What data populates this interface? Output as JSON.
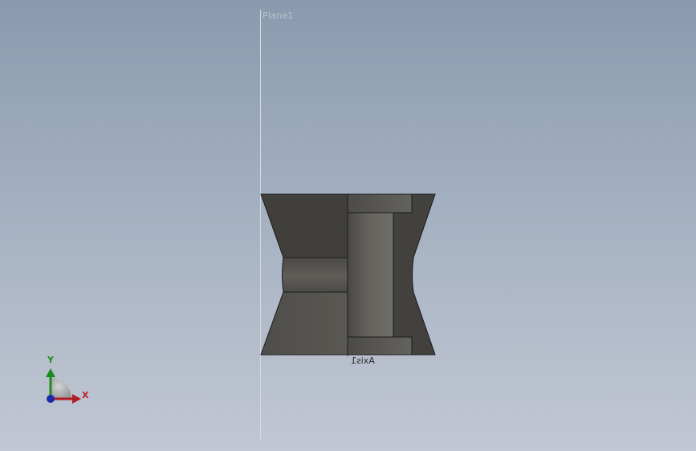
{
  "labels": {
    "plane": "Plane1",
    "axis": "Axis1"
  },
  "triad": {
    "x_label": "X",
    "y_label": "Y",
    "x_color": "#b01c25",
    "y_color": "#1e8a1e",
    "z_color": "#1a2aa8"
  },
  "colors": {
    "background_top": "#8a9aae",
    "background_bottom": "#c2c7d3",
    "part_dark": "#403f3c",
    "part_mid": "#55534e",
    "part_light": "#6b6964",
    "edge": "#1b1b1b"
  }
}
